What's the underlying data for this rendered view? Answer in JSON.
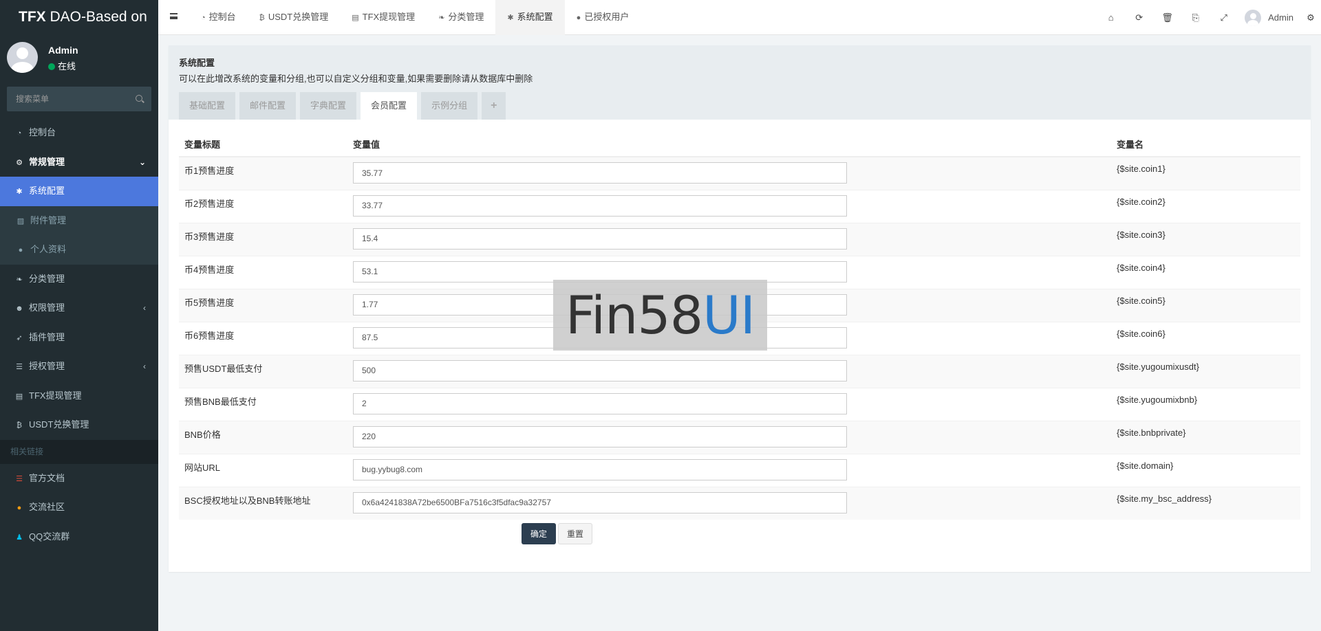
{
  "sidebar": {
    "logo_bold": "TFX",
    "logo_rest": " DAO-Based on",
    "user_name": "Admin",
    "user_status": "在线",
    "search_placeholder": "搜索菜单",
    "items": [
      {
        "label": "控制台",
        "icon": "dashboard-icon"
      },
      {
        "label": "常规管理",
        "icon": "cogs-icon"
      },
      {
        "label": "系统配置",
        "icon": "gear-icon"
      },
      {
        "label": "附件管理",
        "icon": "image-icon"
      },
      {
        "label": "个人资料",
        "icon": "user-icon"
      },
      {
        "label": "分类管理",
        "icon": "leaf-icon"
      },
      {
        "label": "权限管理",
        "icon": "group-icon"
      },
      {
        "label": "插件管理",
        "icon": "rocket-icon"
      },
      {
        "label": "授权管理",
        "icon": "list-icon"
      },
      {
        "label": "TFX提现管理",
        "icon": "card-icon"
      },
      {
        "label": "USDT兑换管理",
        "icon": "bitcoin-icon"
      }
    ],
    "section_header": "相关链接",
    "links": [
      {
        "label": "官方文档",
        "icon": "list-icon",
        "color": "#dd4b39"
      },
      {
        "label": "交流社区",
        "icon": "comment-icon",
        "color": "#f39c12"
      },
      {
        "label": "QQ交流群",
        "icon": "qq-icon",
        "color": "#00c0ef"
      }
    ]
  },
  "topbar": {
    "tabs": [
      {
        "label": "控制台",
        "icon": "dashboard-icon"
      },
      {
        "label": "USDT兑换管理",
        "icon": "bitcoin-icon"
      },
      {
        "label": "TFX提现管理",
        "icon": "card-icon"
      },
      {
        "label": "分类管理",
        "icon": "leaf-icon"
      },
      {
        "label": "系统配置",
        "icon": "gear-icon"
      },
      {
        "label": "已授权用户",
        "icon": "user-icon"
      }
    ],
    "user": "Admin"
  },
  "main": {
    "title": "系统配置",
    "description": "可以在此增改系统的变量和分组,也可以自定义分组和变量,如果需要删除请从数据库中删除",
    "tabs": [
      "基础配置",
      "邮件配置",
      "字典配置",
      "会员配置",
      "示例分组"
    ],
    "add_tab": "+",
    "columns": [
      "变量标题",
      "变量值",
      "变量名"
    ],
    "rows": [
      {
        "title": "币1预售进度",
        "value": "35.77",
        "name": "{$site.coin1}"
      },
      {
        "title": "币2预售进度",
        "value": "33.77",
        "name": "{$site.coin2}"
      },
      {
        "title": "币3预售进度",
        "value": "15.4",
        "name": "{$site.coin3}"
      },
      {
        "title": "币4预售进度",
        "value": "53.1",
        "name": "{$site.coin4}"
      },
      {
        "title": "币5预售进度",
        "value": "1.77",
        "name": "{$site.coin5}"
      },
      {
        "title": "币6预售进度",
        "value": "87.5",
        "name": "{$site.coin6}"
      },
      {
        "title": "预售USDT最低支付",
        "value": "500",
        "name": "{$site.yugoumixusdt}"
      },
      {
        "title": "预售BNB最低支付",
        "value": "2",
        "name": "{$site.yugoumixbnb}"
      },
      {
        "title": "BNB价格",
        "value": "220",
        "name": "{$site.bnbprivate}"
      },
      {
        "title": "网站URL",
        "value": "bug.yybug8.com",
        "name": "{$site.domain}"
      },
      {
        "title": "BSC授权地址以及BNB转账地址",
        "value": "0x6a4241838A72be6500BFa7516c3f5dfac9a32757",
        "name": "{$site.my_bsc_address}"
      }
    ],
    "submit_label": "确定",
    "reset_label": "重置"
  },
  "watermark": {
    "part1": "Fin58",
    "part2": "UI"
  }
}
